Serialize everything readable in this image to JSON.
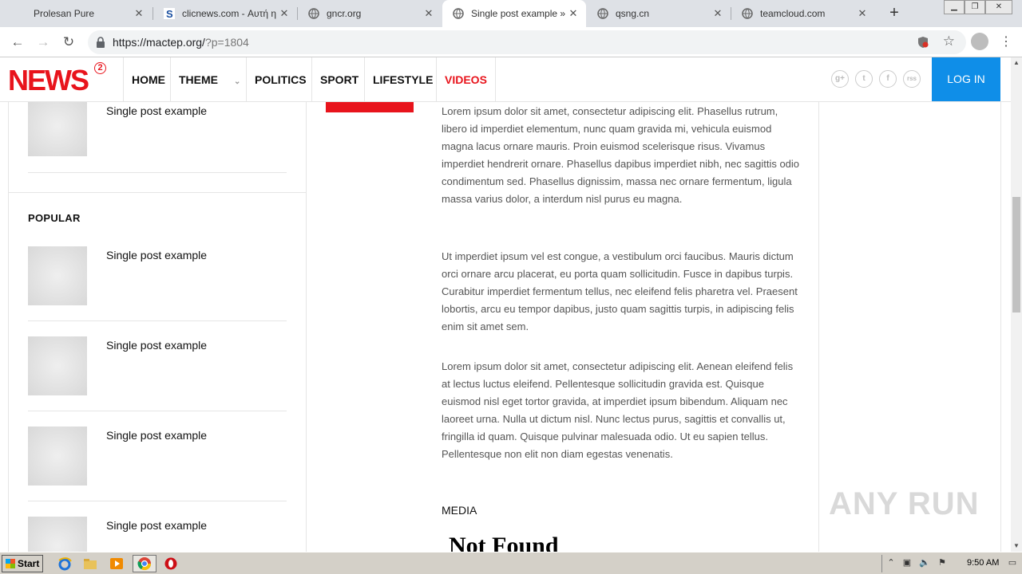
{
  "browser": {
    "tabs": [
      {
        "title": "Prolesan Pure",
        "favicon": "none"
      },
      {
        "title": "clicnews.com - Αυτή η ιστ",
        "favicon": "s-icon"
      },
      {
        "title": "gncr.org",
        "favicon": "globe-icon"
      },
      {
        "title": "Single post example » Ne",
        "favicon": "globe-icon",
        "active": true
      },
      {
        "title": "qsng.cn",
        "favicon": "globe-icon"
      },
      {
        "title": "teamcloud.com",
        "favicon": "globe-icon"
      }
    ],
    "url_host": "https://mactep.org/",
    "url_path": "?p=1804"
  },
  "site": {
    "logo": "NEWS",
    "logo_badge": "2",
    "nav": [
      "HOME",
      "THEME",
      "POLITICS",
      "SPORT",
      "LIFESTYLE",
      "VIDEOS"
    ],
    "login": "LOG IN",
    "social": [
      "g+",
      "t",
      "f",
      "rss"
    ]
  },
  "sidebar": {
    "top_item": "Single post example",
    "popular_title": "POPULAR",
    "popular_items": [
      "Single post example",
      "Single post example",
      "Single post example",
      "Single post example"
    ]
  },
  "article": {
    "paragraphs": [
      "Lorem ipsum dolor sit amet, consectetur adipiscing elit. Phasellus rutrum, libero id imperdiet elementum, nunc quam gravida mi, vehicula euismod magna lacus ornare mauris. Proin euismod scelerisque risus. Vivamus imperdiet hendrerit ornare. Phasellus dapibus imperdiet nibh, nec sagittis odio condimentum sed. Phasellus dignissim, massa nec ornare fermentum, ligula massa varius dolor, a interdum nisl purus eu magna.",
      "Ut imperdiet ipsum vel est congue, a vestibulum orci faucibus. Mauris dictum orci ornare arcu placerat, eu porta quam sollicitudin. Fusce in dapibus turpis. Curabitur imperdiet fermentum tellus, nec eleifend felis pharetra vel. Praesent lobortis, arcu eu tempor dapibus, justo quam sagittis turpis, in adipiscing felis enim sit amet sem.",
      "Lorem ipsum dolor sit amet, consectetur adipiscing elit. Aenean eleifend felis at lectus luctus eleifend. Pellentesque sollicitudin gravida est. Quisque euismod nisl eget tortor gravida, at imperdiet ipsum bibendum. Aliquam nec laoreet urna. Nulla ut dictum nisl. Nunc lectus purus, sagittis et convallis ut, fringilla id quam. Quisque pulvinar malesuada odio. Ut eu sapien tellus. Pellentesque non elit non diam egestas venenatis."
    ],
    "media_label": "MEDIA",
    "not_found": "Not Found"
  },
  "watermark": "ANY RUN",
  "taskbar": {
    "start": "Start",
    "clock": "9:50 AM"
  }
}
